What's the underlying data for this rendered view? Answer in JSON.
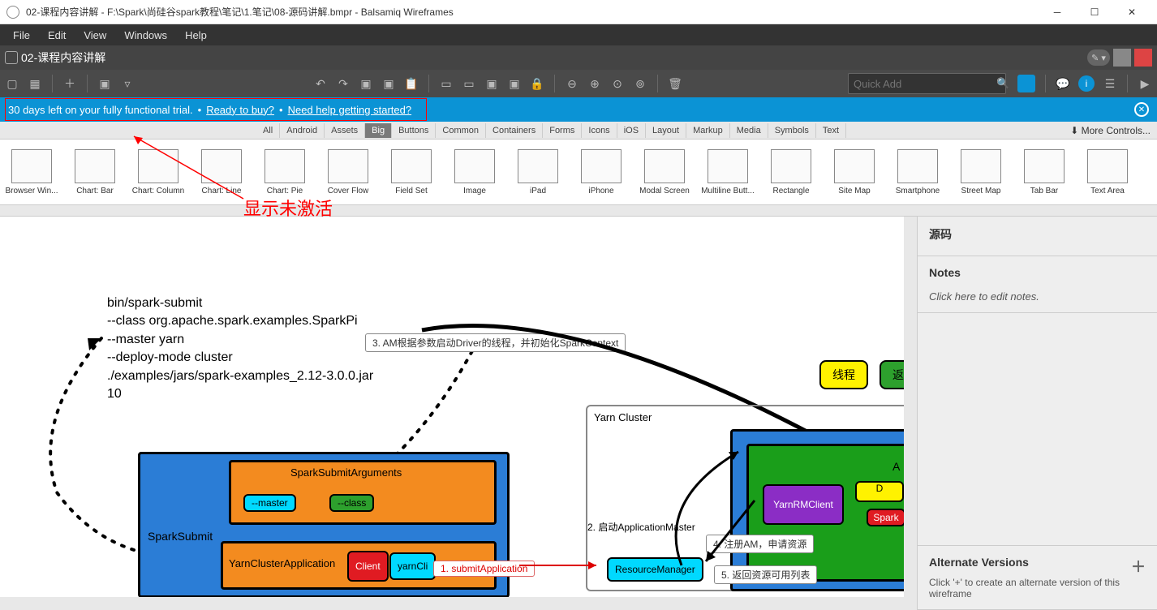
{
  "title": "02-课程内容讲解 - F:\\Spark\\尚硅谷spark教程\\笔记\\1.笔记\\08-源码讲解.bmpr - Balsamiq Wireframes",
  "menus": [
    "File",
    "Edit",
    "View",
    "Windows",
    "Help"
  ],
  "tab_name": "02-课程内容讲解",
  "search_placeholder": "Quick Add",
  "banner": {
    "trial": "30 days left on your fully functional trial.",
    "buy": "Ready to buy?",
    "help": "Need help getting started?",
    "sep": "•"
  },
  "annotation": "显示未激活",
  "gallery_tabs": [
    "All",
    "Android",
    "Assets",
    "Big",
    "Buttons",
    "Common",
    "Containers",
    "Forms",
    "Icons",
    "iOS",
    "Layout",
    "Markup",
    "Media",
    "Symbols",
    "Text"
  ],
  "more_controls": "⬇ More Controls...",
  "gallery_items": [
    "Browser Win...",
    "Chart: Bar",
    "Chart: Column",
    "Chart: Line",
    "Chart: Pie",
    "Cover Flow",
    "Field Set",
    "Image",
    "iPad",
    "iPhone",
    "Modal Screen",
    "Multiline Butt...",
    "Rectangle",
    "Site Map",
    "Smartphone",
    "Street Map",
    "Tab Bar",
    "Text Area"
  ],
  "side": {
    "src_title": "源码",
    "notes_title": "Notes",
    "notes_text": "Click here to edit notes.",
    "alt_title": "Alternate Versions",
    "alt_text": "Click '+' to create an alternate version of this wireframe"
  },
  "diagram": {
    "code_lines": [
      "bin/spark-submit",
      "--class org.apache.spark.examples.SparkPi",
      "--master yarn",
      "--deploy-mode cluster",
      "./examples/jars/spark-examples_2.12-3.0.0.jar",
      "10"
    ],
    "callout3": "3. AM根据参数启动Driver的线程，并初始化SparkContext",
    "btn_thread": "线程",
    "btn_return": "返",
    "yarn_cluster": "Yarn Cluster",
    "spark_submit": "SparkSubmit",
    "spark_submit_args": "SparkSubmitArguments",
    "master": "--master",
    "class": "--class",
    "yarn_cluster_app": "YarnClusterApplication",
    "client": "Client",
    "yarn_cli": "yarnCli",
    "submit_app": "1. submitApplication",
    "start_am": "2. 启动ApplicationMaster",
    "register_am": "4. 注册AM，申请资源",
    "return_res": "5. 返回资源可用列表",
    "resource_mgr": "ResourceManager",
    "yarn_rm_client": "YarnRMClient",
    "spark": "Spark",
    "a_label": "A",
    "d_label": "D"
  }
}
